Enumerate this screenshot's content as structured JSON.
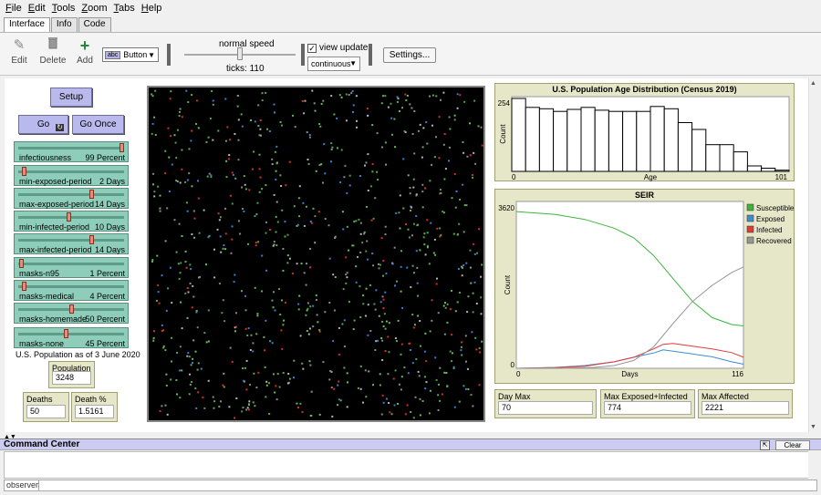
{
  "menu": [
    {
      "key": "F",
      "rest": "ile"
    },
    {
      "key": "E",
      "rest": "dit"
    },
    {
      "key": "T",
      "rest": "ools"
    },
    {
      "key": "Z",
      "rest": "oom"
    },
    {
      "key": "T",
      "rest": "abs"
    },
    {
      "key": "H",
      "rest": "elp"
    }
  ],
  "tabs": [
    "Interface",
    "Info",
    "Code"
  ],
  "toolbar": {
    "edit": "Edit",
    "delete": "Delete",
    "add": "Add",
    "widget_abc": "abc",
    "widget_type": "Button",
    "speed_label": "normal speed",
    "speed_fraction": 0.5,
    "ticks_label": "ticks: 110",
    "view_updates": "view updates",
    "view_updates_checked": true,
    "update_mode": "continuous",
    "settings": "Settings..."
  },
  "buttons": {
    "setup": "Setup",
    "go": "Go",
    "go_once": "Go Once"
  },
  "sliders": [
    {
      "name": "infectiousness",
      "value": "99 Percent",
      "frac": 0.99
    },
    {
      "name": "min-exposed-period",
      "value": "2 Days",
      "frac": 0.04
    },
    {
      "name": "max-exposed-period",
      "value": "14 Days",
      "frac": 0.7
    },
    {
      "name": "min-infected-period",
      "value": "10 Days",
      "frac": 0.47
    },
    {
      "name": "max-infected-period",
      "value": "14 Days",
      "frac": 0.7
    },
    {
      "name": "masks-n95",
      "value": "1 Percent",
      "frac": 0.01
    },
    {
      "name": "masks-medical",
      "value": "4 Percent",
      "frac": 0.04
    },
    {
      "name": "masks-homemade",
      "value": "50 Percent",
      "frac": 0.5
    },
    {
      "name": "masks-none",
      "value": "45 Percent",
      "frac": 0.45
    }
  ],
  "population_note": "U.S. Population as of 3 June 2020",
  "monitors": {
    "population": {
      "label": "Population",
      "value": "3248"
    },
    "deaths": {
      "label": "Deaths",
      "value": "50"
    },
    "death_pct": {
      "label": "Death %",
      "value": "1.5161"
    },
    "day_max": {
      "label": "Day Max Exposed+Infected",
      "value": "70"
    },
    "max_exposed": {
      "label": "Max Exposed+Infected",
      "value": "774"
    },
    "max_affected": {
      "label": "Max Affected",
      "value": "2221"
    }
  },
  "chart_data": [
    {
      "type": "bar",
      "title": "U.S. Population Age Distribution (Census 2019)",
      "xlabel": "Age",
      "ylabel": "Count",
      "xlim": [
        0,
        101
      ],
      "ylim": [
        0,
        254
      ],
      "xticks": [
        "0",
        "101"
      ],
      "yticks": [
        "254"
      ],
      "values": [
        254,
        223,
        218,
        209,
        216,
        223,
        213,
        209,
        209,
        209,
        226,
        218,
        170,
        146,
        93,
        93,
        68,
        19,
        11,
        4
      ]
    },
    {
      "type": "line",
      "title": "SEIR",
      "xlabel": "Days",
      "ylabel": "Count",
      "xlim": [
        0,
        116
      ],
      "ylim": [
        0,
        3620
      ],
      "xticks": [
        "0",
        "116"
      ],
      "yticks": [
        "3620",
        "0"
      ],
      "legend_position": "right",
      "series": [
        {
          "name": "Susceptible",
          "color": "#3cb43c",
          "points": [
            [
              0,
              3400
            ],
            [
              20,
              3340
            ],
            [
              35,
              3230
            ],
            [
              50,
              3040
            ],
            [
              60,
              2830
            ],
            [
              70,
              2450
            ],
            [
              80,
              1950
            ],
            [
              90,
              1450
            ],
            [
              100,
              1100
            ],
            [
              110,
              950
            ],
            [
              116,
              920
            ]
          ]
        },
        {
          "name": "Exposed",
          "color": "#3c8cd2",
          "points": [
            [
              0,
              0
            ],
            [
              20,
              20
            ],
            [
              35,
              60
            ],
            [
              50,
              140
            ],
            [
              60,
              240
            ],
            [
              70,
              330
            ],
            [
              75,
              400
            ],
            [
              80,
              370
            ],
            [
              90,
              310
            ],
            [
              100,
              250
            ],
            [
              110,
              140
            ],
            [
              116,
              90
            ]
          ]
        },
        {
          "name": "Infected",
          "color": "#e03a3a",
          "points": [
            [
              0,
              0
            ],
            [
              20,
              15
            ],
            [
              35,
              45
            ],
            [
              50,
              140
            ],
            [
              60,
              240
            ],
            [
              70,
              420
            ],
            [
              75,
              520
            ],
            [
              80,
              540
            ],
            [
              90,
              480
            ],
            [
              100,
              420
            ],
            [
              110,
              340
            ],
            [
              116,
              240
            ]
          ]
        },
        {
          "name": "Recovered",
          "color": "#969696",
          "points": [
            [
              0,
              0
            ],
            [
              25,
              5
            ],
            [
              40,
              20
            ],
            [
              50,
              60
            ],
            [
              60,
              170
            ],
            [
              70,
              460
            ],
            [
              80,
              970
            ],
            [
              90,
              1450
            ],
            [
              100,
              1800
            ],
            [
              110,
              2080
            ],
            [
              116,
              2200
            ]
          ]
        }
      ]
    }
  ],
  "command_center": {
    "title": "Command Center",
    "clear": "Clear",
    "observer": "observer>"
  }
}
